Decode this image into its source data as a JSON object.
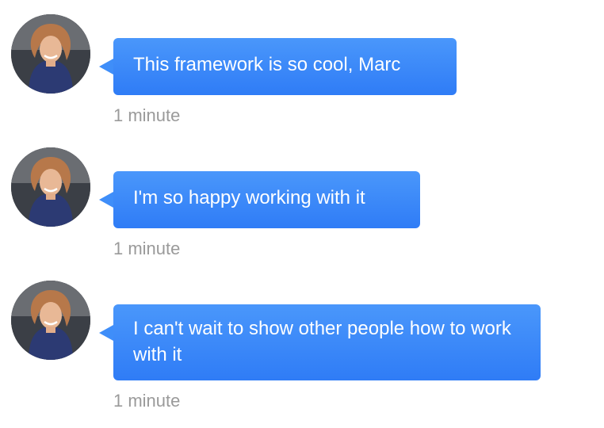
{
  "messages": [
    {
      "text": "This framework is so cool, Marc",
      "time": "1 minute"
    },
    {
      "text": "I'm so happy working with it",
      "time": "1 minute"
    },
    {
      "text": "I can't wait to show other people how to work with it",
      "time": "1 minute"
    }
  ],
  "colors": {
    "bubble": "#3a88f8",
    "time_text": "#9a9a9a"
  },
  "icons": {
    "avatar": "user-photo"
  }
}
